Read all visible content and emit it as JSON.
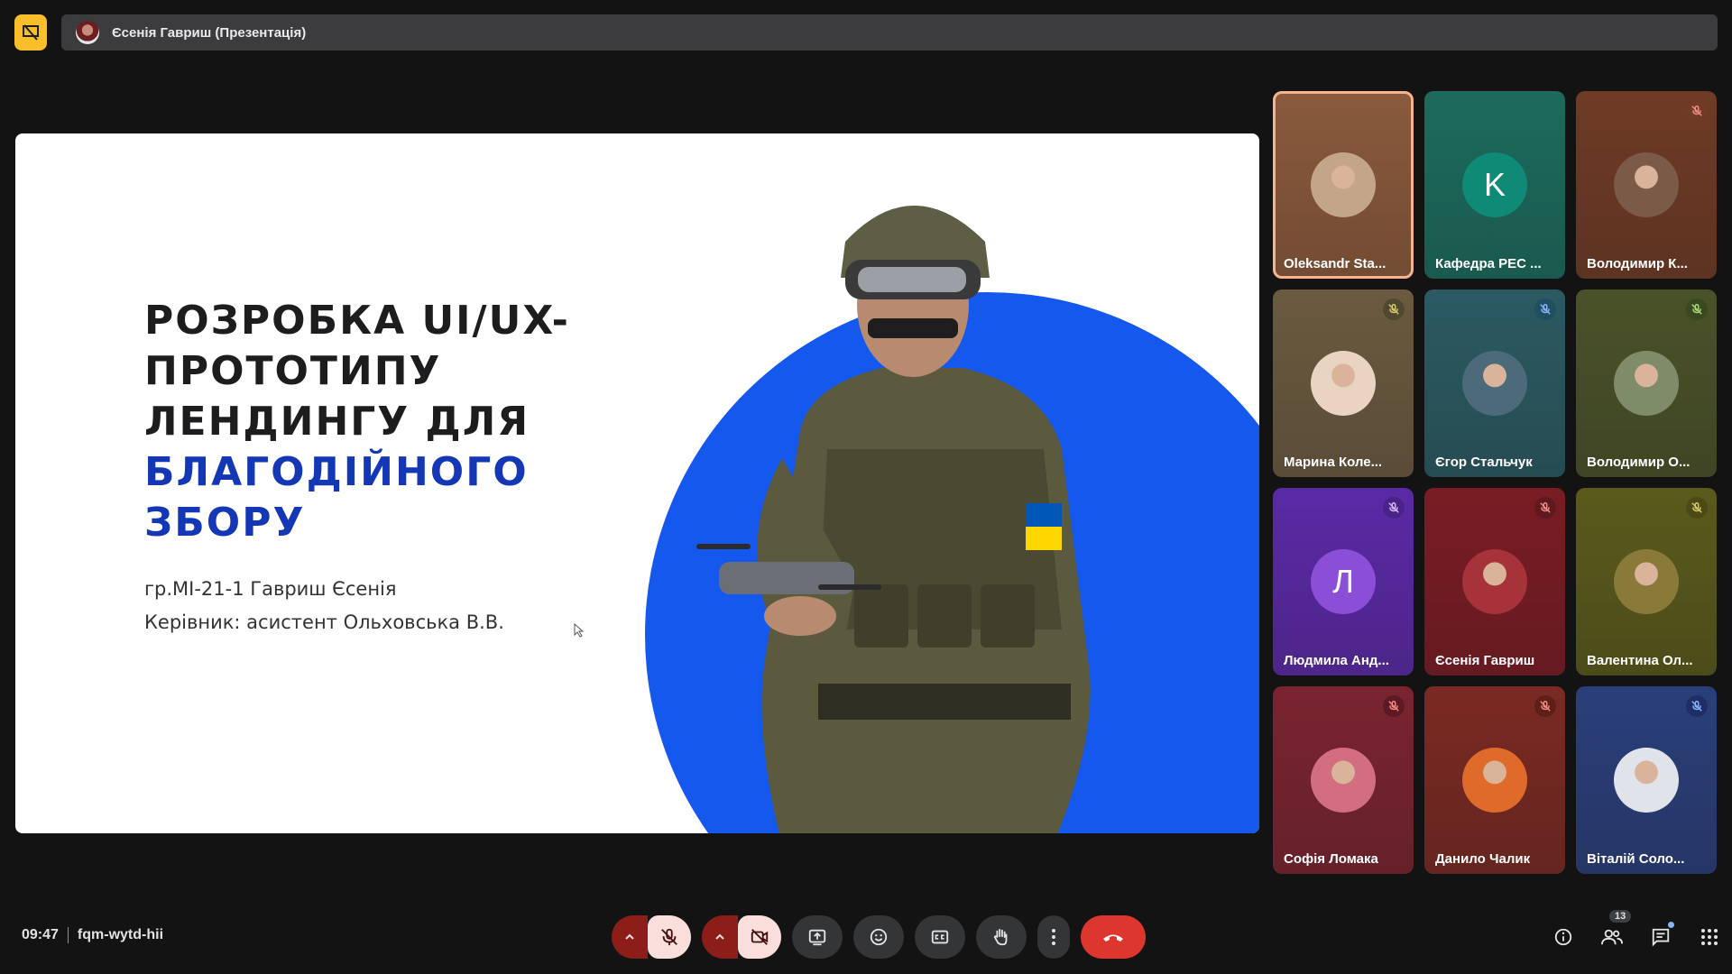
{
  "presenter": {
    "title": "Єсенія Гавриш (Презентація)"
  },
  "slide": {
    "title_lines": [
      "РОЗРОБКА UI/UX-",
      "ПРОТОТИПУ",
      "ЛЕНДИНГУ ДЛЯ"
    ],
    "title_blue_lines": [
      "БЛАГОДІЙНОГО",
      "ЗБОРУ"
    ],
    "subtitle_1": "гр.МІ-21-1 Гавриш Єсенія",
    "subtitle_2": "Керівник: асистент Ольховська В.В."
  },
  "participants": [
    {
      "name": "Oleksandr Sta...",
      "bg": "#8a5a3c",
      "avatar": "photo",
      "avatar_color": "#c3a68a",
      "mute": false,
      "active": true
    },
    {
      "name": "Кафедра РЕС ...",
      "bg": "#1c6b5d",
      "avatar": "letter",
      "letter": "K",
      "avatar_color": "#0f8a76",
      "mute": false,
      "active": false
    },
    {
      "name": "Володимир К...",
      "bg": "#6f3b25",
      "avatar": "photo",
      "avatar_color": "#7b5a48",
      "mute": true,
      "mute_bg": "#6f3b25",
      "mute_color": "#f28b82",
      "active": false
    },
    {
      "name": "Марина Коле...",
      "bg": "#6b5a3f",
      "avatar": "photo",
      "avatar_color": "#e8d4c0",
      "mute": true,
      "mute_bg": "#4f4a2f",
      "mute_color": "#d6c86a",
      "active": false
    },
    {
      "name": "Єгор Стальчук",
      "bg": "#2b5a62",
      "avatar": "photo",
      "avatar_color": "#4c6a7a",
      "mute": true,
      "mute_bg": "#1f4f60",
      "mute_color": "#8ab4f8",
      "active": false
    },
    {
      "name": "Володимир О...",
      "bg": "#4a5229",
      "avatar": "photo",
      "avatar_color": "#7f8c6a",
      "mute": true,
      "mute_bg": "#3a4a20",
      "mute_color": "#a8d67a",
      "active": false
    },
    {
      "name": "Людмила Анд...",
      "bg": "#5a2aa6",
      "avatar": "letter",
      "letter": "Л",
      "avatar_color": "#8a4fd6",
      "mute": true,
      "mute_bg": "#4a2388",
      "mute_color": "#d7b8ff",
      "active": false
    },
    {
      "name": "Єсенія Гавриш",
      "bg": "#7a1c24",
      "avatar": "photo",
      "avatar_color": "#a6323a",
      "mute": true,
      "mute_bg": "#5e1a20",
      "mute_color": "#f28b82",
      "active": false
    },
    {
      "name": "Валентина Ол...",
      "bg": "#5a5a1c",
      "avatar": "photo",
      "avatar_color": "#8a7a3a",
      "mute": true,
      "mute_bg": "#4a4a16",
      "mute_color": "#d6c86a",
      "active": false
    },
    {
      "name": "Софія Ломака",
      "bg": "#7a2430",
      "avatar": "photo",
      "avatar_color": "#d26e80",
      "mute": true,
      "mute_bg": "#5e1a24",
      "mute_color": "#f28b82",
      "active": false
    },
    {
      "name": "Данило Чалик",
      "bg": "#7a2a22",
      "avatar": "photo",
      "avatar_color": "#e06a2a",
      "mute": true,
      "mute_bg": "#5e1f18",
      "mute_color": "#f28b82",
      "active": false
    },
    {
      "name": "Віталій Соло...",
      "bg": "#2a3f7a",
      "avatar": "photo",
      "avatar_color": "#e0e4ea",
      "mute": true,
      "mute_bg": "#1f2f66",
      "mute_color": "#8ab4f8",
      "active": false
    }
  ],
  "footer": {
    "time": "09:47",
    "meeting_code": "fqm-wytd-hii",
    "participant_count": "13"
  },
  "icons": {
    "mic": "mic-off-icon",
    "cam": "camera-off-icon",
    "present": "present-icon",
    "emoji": "emoji-icon",
    "captions": "captions-icon",
    "hand": "raise-hand-icon",
    "more": "more-vert-icon",
    "end": "end-call-icon"
  }
}
